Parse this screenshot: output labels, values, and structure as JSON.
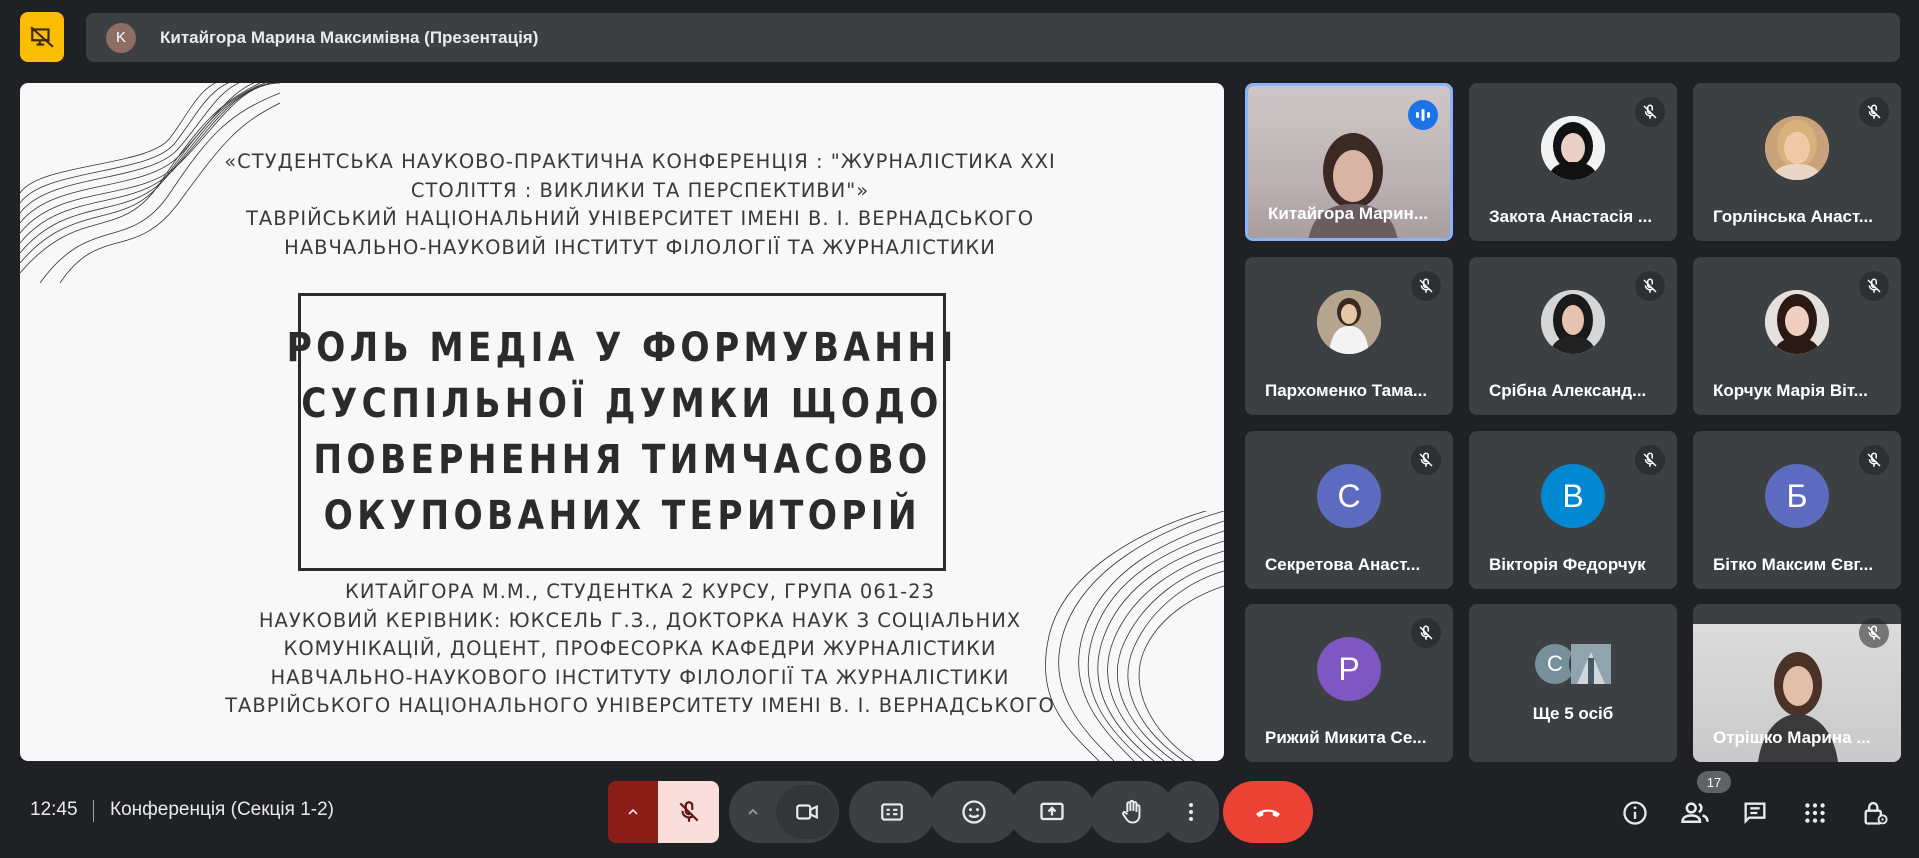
{
  "top_bar": {
    "presenter_initial": "K",
    "presenter_label": "Китайгора Марина Максимівна (Презентація)"
  },
  "slide": {
    "header_lines": [
      "«СТУДЕНТСЬКА НАУКОВО-ПРАКТИЧНА КОНФЕРЕНЦІЯ : \"ЖУРНАЛІСТИКА ХХІ",
      "СТОЛІТТЯ : ВИКЛИКИ ТА ПЕРСПЕКТИВИ\"»",
      "ТАВРІЙСЬКИЙ НАЦІОНАЛЬНИЙ УНІВЕРСИТЕТ ІМЕНІ В. І. ВЕРНАДСЬКОГО",
      "НАВЧАЛЬНО-НАУКОВИЙ ІНСТИТУТ ФІЛОЛОГІЇ ТА ЖУРНАЛІСТИКИ"
    ],
    "title_lines": [
      "РОЛЬ МЕДІА У ФОРМУВАННІ",
      "СУСПІЛЬНОЇ ДУМКИ ЩОДО",
      "ПОВЕРНЕННЯ ТИМЧАСОВО",
      "ОКУПОВАНИХ ТЕРИТОРІЙ"
    ],
    "footer_lines": [
      "КИТАЙГОРА М.М., СТУДЕНТКА 2 КУРСУ, ГРУПА 061-23",
      "НАУКОВИЙ КЕРІВНИК: ЮКСЕЛЬ Г.З., ДОКТОРКА НАУК З СОЦІАЛЬНИХ",
      "КОМУНІКАЦІЙ, ДОЦЕНТ, ПРОФЕСОРКА КАФЕДРИ ЖУРНАЛІСТИКИ",
      "НАВЧАЛЬНО-НАУКОВОГО ІНСТИТУТУ ФІЛОЛОГІЇ ТА ЖУРНАЛІСТИКИ",
      "ТАВРІЙСЬКОГО НАЦІОНАЛЬНОГО УНІВЕРСИТЕТУ ІМЕНІ В. І. ВЕРНАДСЬКОГО"
    ]
  },
  "participants": [
    {
      "name": "Китайгора Марин...",
      "kind": "camera",
      "mic": "speaking"
    },
    {
      "name": "Закота Анастасія ...",
      "kind": "photo",
      "mic": "muted"
    },
    {
      "name": "Горлінська Анаст...",
      "kind": "photo",
      "mic": "muted"
    },
    {
      "name": "Пархоменко Тама...",
      "kind": "photo",
      "mic": "muted"
    },
    {
      "name": "Срібна Александ...",
      "kind": "photo",
      "mic": "muted"
    },
    {
      "name": "Корчук Марія Віт...",
      "kind": "photo",
      "mic": "muted"
    },
    {
      "name": "Секретова Анаст...",
      "kind": "letter",
      "letter": "С",
      "color": "#5c6bc0",
      "mic": "muted"
    },
    {
      "name": "Вікторія Федорчук",
      "kind": "letter",
      "letter": "В",
      "color": "#0288d1",
      "mic": "muted"
    },
    {
      "name": "Бітко Максим Євг...",
      "kind": "letter",
      "letter": "Б",
      "color": "#5c6bc0",
      "mic": "muted"
    },
    {
      "name": "Рижий Микита Се...",
      "kind": "letter",
      "letter": "Р",
      "color": "#7e57c2",
      "mic": "muted"
    },
    {
      "name": "Ще 5 осіб",
      "kind": "more",
      "letter": "С",
      "color": "#78909c"
    },
    {
      "name": "Отрішко Марина ...",
      "kind": "camera2",
      "mic": "muted"
    }
  ],
  "bottom_bar": {
    "time": "12:45",
    "meeting_title": "Конференція (Секція 1-2)",
    "people_count": "17",
    "icons": [
      "chevron-up-icon",
      "mic-off-icon",
      "videocam-icon",
      "closed-caption-icon",
      "emoji-icon",
      "present-screen-icon",
      "raise-hand-icon",
      "more-vert-icon",
      "call-end-icon",
      "info-icon",
      "people-icon",
      "chat-icon",
      "apps-icon",
      "host-controls-icon"
    ]
  },
  "colors": {
    "background": "#202124",
    "tile": "#3c4043",
    "accent_yellow": "#fbbc04",
    "end_call": "#ea4335",
    "mic_off_bg": "#f9dedc",
    "speaking": "#1a73e8"
  }
}
